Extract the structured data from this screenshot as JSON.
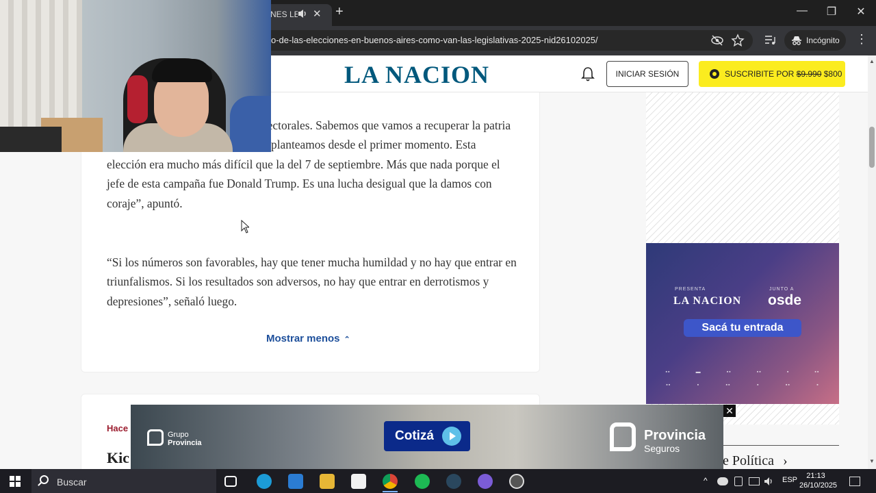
{
  "browser": {
    "tab_title": "NES LEC",
    "url": "o-de-las-elecciones-en-buenos-aires-como-van-las-legislativas-2025-nid26102025/",
    "incognito_label": "Incógnito",
    "new_tab": "+",
    "close_tab": "✕",
    "menu": "⋮",
    "win_min": "—",
    "win_max": "❐",
    "win_close": "✕"
  },
  "site": {
    "logo": "LA NACION",
    "login_label": "INICIAR SESIÓN",
    "subscribe_prefix": "SUSCRIBITE POR",
    "subscribe_old_price": "$9.990",
    "subscribe_new_price": "$800"
  },
  "article": {
    "para1": "Estaría incumpliendo las reglas electorales. Sabemos que vamos a recuperar la patria de un gobierno de ocupación. Los planteamos desde el primer momento. Esta elección era mucho más difícil que la del 7 de septiembre. Más que nada porque el jefe de esta campaña fue Donald Trump. Es una lucha desigual que la damos con coraje”, apuntó.",
    "para2": "“Si los números son favorables, hay que tener mucha humildad y no hay que entrar en triunfalismos. Si los resultados son adversos, no hay que entrar en derrotismos y depresiones”, señaló luego.",
    "show_less": "Mostrar menos",
    "show_less_chevron": "⌃"
  },
  "next_card": {
    "time": "Hace",
    "headline_start": "Kic"
  },
  "side_ad": {
    "presenta": "PRESENTA",
    "junto_a": "JUNTO A",
    "brand": "LA NACION",
    "partner": "osde",
    "cta": "Sacá tu entrada"
  },
  "section_link": {
    "label": "e Política",
    "chevron": "›"
  },
  "bottom_ad": {
    "grupo_line1": "Grupo",
    "grupo_line2": "Provincia",
    "cta": "Cotizá",
    "brand_line1": "Provincia",
    "brand_line2": "Seguros",
    "close": "✕"
  },
  "taskbar": {
    "search_label": "Buscar",
    "language": "ESP",
    "time": "21:13",
    "date": "26/10/2025",
    "tray_arrow": "^"
  },
  "colors": {
    "logo": "#00587c",
    "subscribe_bg": "#fbec1f",
    "link": "#1d4f9b",
    "time_label": "#9b1c2e"
  }
}
